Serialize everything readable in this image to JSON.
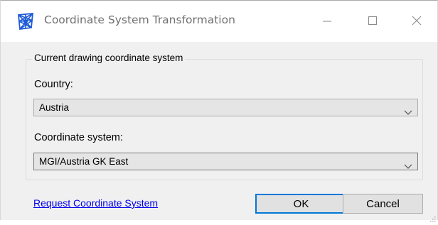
{
  "window": {
    "title": "Coordinate System Transformation",
    "app_icon": "app-logo-icon",
    "controls": {
      "minimize_icon": "minimize-icon",
      "maximize_icon": "maximize-icon",
      "close_icon": "close-icon"
    }
  },
  "group": {
    "legend": "Current drawing coordinate system"
  },
  "country": {
    "label": "Country:",
    "value": "Austria",
    "icon": "chevron-down-icon"
  },
  "coordinate_system": {
    "label": "Coordinate system:",
    "value": "MGI/Austria GK East",
    "icon": "chevron-down-icon"
  },
  "footer": {
    "link": "Request Coordinate System",
    "ok_label": "OK",
    "cancel_label": "Cancel"
  },
  "colors": {
    "accent": "#0078d7",
    "link": "#0000ee",
    "dialog_bg": "#f0f0f0",
    "icon_blue": "#1e5bd6"
  }
}
